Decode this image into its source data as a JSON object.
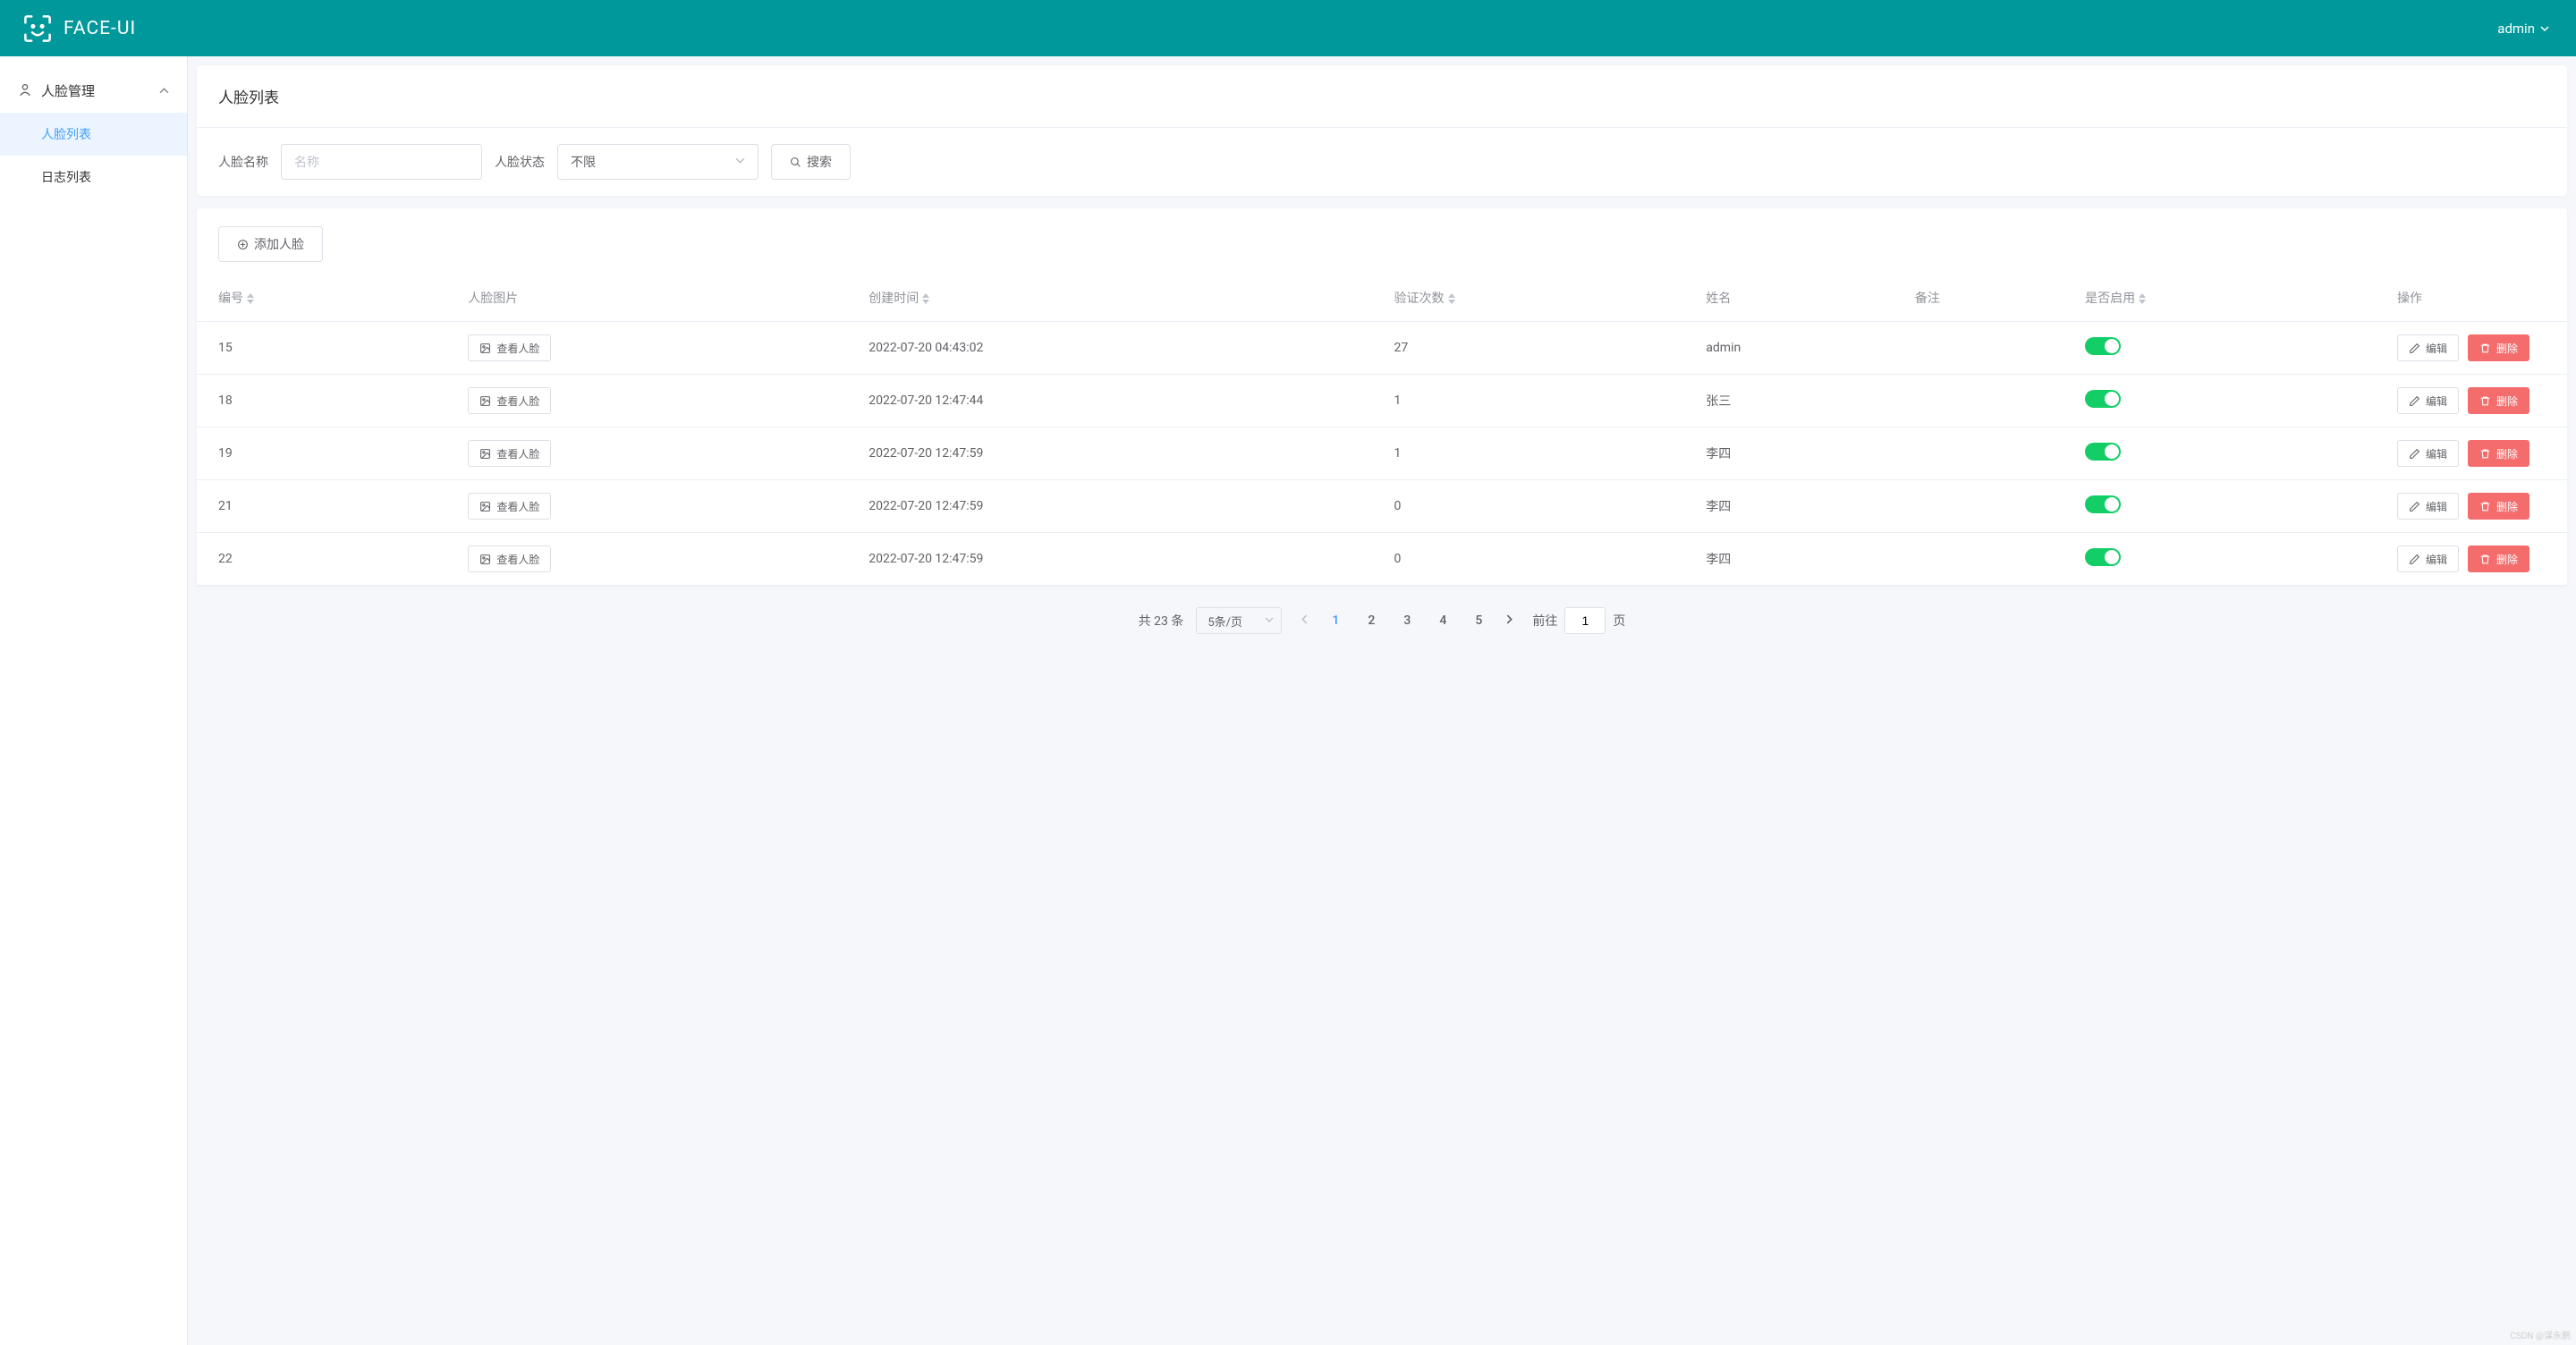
{
  "app": {
    "name": "FACE-UI",
    "user": "admin"
  },
  "sidebar": {
    "group_title": "人脸管理",
    "items": [
      {
        "label": "人脸列表",
        "active": true
      },
      {
        "label": "日志列表",
        "active": false
      }
    ]
  },
  "page": {
    "title": "人脸列表",
    "filters": {
      "name_label": "人脸名称",
      "name_placeholder": "名称",
      "status_label": "人脸状态",
      "status_value": "不限",
      "search_btn": "搜索"
    },
    "add_btn": "添加人脸",
    "table": {
      "headers": {
        "id": "编号",
        "image": "人脸图片",
        "created": "创建时间",
        "verify_count": "验证次数",
        "name": "姓名",
        "remark": "备注",
        "enabled": "是否启用",
        "ops": "操作"
      },
      "view_btn": "查看人脸",
      "edit_btn": "编辑",
      "delete_btn": "删除",
      "rows": [
        {
          "id": "15",
          "created": "2022-07-20 04:43:02",
          "verify_count": "27",
          "name": "admin",
          "remark": "",
          "enabled": true
        },
        {
          "id": "18",
          "created": "2022-07-20 12:47:44",
          "verify_count": "1",
          "name": "张三",
          "remark": "",
          "enabled": true
        },
        {
          "id": "19",
          "created": "2022-07-20 12:47:59",
          "verify_count": "1",
          "name": "李四",
          "remark": "",
          "enabled": true
        },
        {
          "id": "21",
          "created": "2022-07-20 12:47:59",
          "verify_count": "0",
          "name": "李四",
          "remark": "",
          "enabled": true
        },
        {
          "id": "22",
          "created": "2022-07-20 12:47:59",
          "verify_count": "0",
          "name": "李四",
          "remark": "",
          "enabled": true
        }
      ]
    },
    "pagination": {
      "total_label": "共 23 条",
      "page_size": "5条/页",
      "pages": [
        "1",
        "2",
        "3",
        "4",
        "5"
      ],
      "current": "1",
      "goto_prefix": "前往",
      "goto_value": "1",
      "goto_suffix": "页"
    }
  },
  "watermark": "CSDN @谋永鹏"
}
